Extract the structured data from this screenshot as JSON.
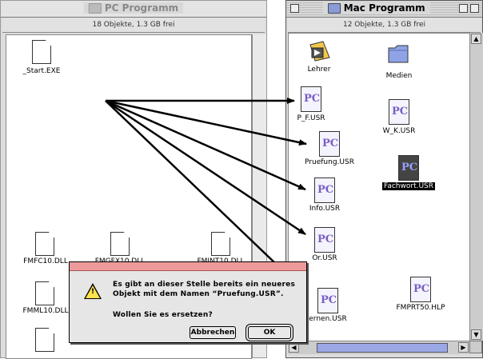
{
  "pc_window": {
    "title": "PC Programm",
    "status": "18 Objekte, 1.3 GB frei",
    "icons": [
      {
        "name": "_Start.EXE"
      },
      {
        "name": "FMFC10.DLL"
      },
      {
        "name": "FMGFX10.DLL"
      },
      {
        "name": "FMINT10.DLL"
      },
      {
        "name": "FMML10.DLL"
      }
    ]
  },
  "mac_window": {
    "title": "Mac Programm",
    "status": "12 Objekte, 1.3 GB frei",
    "icons": [
      {
        "name": "Lehrer"
      },
      {
        "name": "Medien"
      },
      {
        "name": "P_F.USR"
      },
      {
        "name": "W_K.USR"
      },
      {
        "name": "Pruefung.USR"
      },
      {
        "name": "Fachwort.USR"
      },
      {
        "name": "Info.USR"
      },
      {
        "name": "Or.USR"
      },
      {
        "name": "ernen.USR"
      },
      {
        "name": "FMPRT50.HLP"
      }
    ]
  },
  "dialog": {
    "line1": "Es gibt an dieser Stelle bereits ein neueres",
    "line2": "Objekt mit dem Namen “Pruefung.USR”.",
    "line3": "Wollen Sie es ersetzen?",
    "cancel_label": "Abbrechen",
    "ok_label": "OK"
  }
}
